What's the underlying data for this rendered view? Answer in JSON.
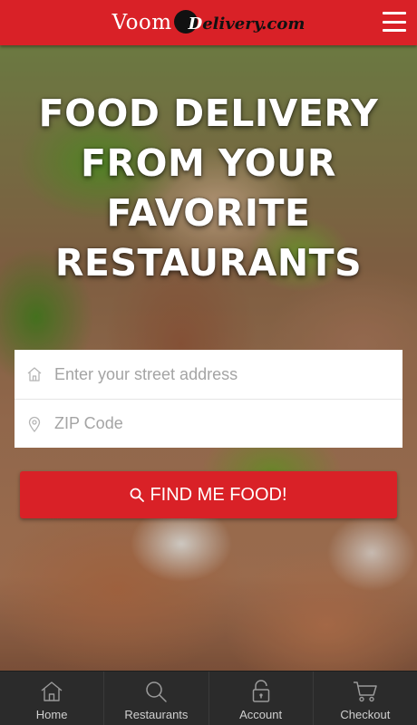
{
  "header": {
    "logo_voom": "Voom",
    "logo_delivery_first": "D",
    "logo_delivery_rest": "elivery.com",
    "accent_color": "#d92127",
    "menu_icon": "hamburger-menu-icon"
  },
  "hero": {
    "headline_lines": [
      "FOOD DELIVERY",
      "FROM YOUR",
      "FAVORITE",
      "RESTAURANTS"
    ]
  },
  "form": {
    "address_placeholder": "Enter your street address",
    "address_value": "",
    "address_icon": "home-icon",
    "zip_placeholder": "ZIP Code",
    "zip_value": "",
    "zip_icon": "location-pin-icon"
  },
  "cta": {
    "label": "FIND ME FOOD!",
    "icon": "search-icon"
  },
  "bottom_nav": {
    "items": [
      {
        "label": "Home",
        "icon": "home-icon"
      },
      {
        "label": "Restaurants",
        "icon": "search-icon"
      },
      {
        "label": "Account",
        "icon": "lock-icon"
      },
      {
        "label": "Checkout",
        "icon": "cart-icon"
      }
    ]
  }
}
